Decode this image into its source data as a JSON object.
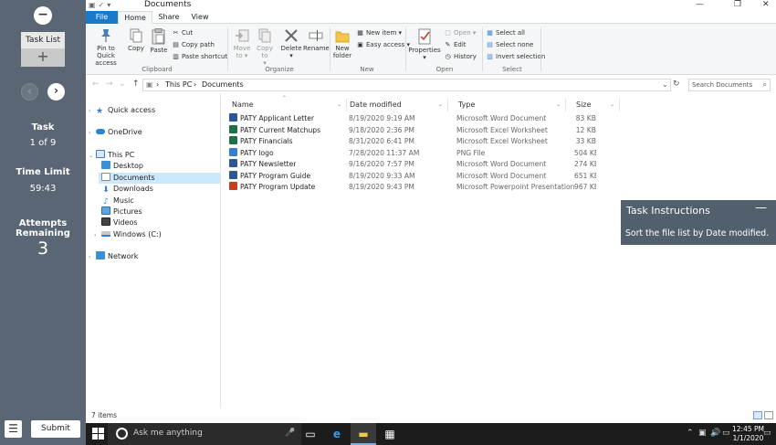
{
  "panel": {
    "minimize_glyph": "−",
    "task_list_label": "Task List",
    "task_list_add": "+",
    "prev_glyph": "‹",
    "next_glyph": "›",
    "task_heading": "Task",
    "task_value": "1 of 9",
    "time_limit_heading": "Time Limit",
    "time_limit_value": "59:43",
    "attempts_heading_1": "Attempts",
    "attempts_heading_2": "Remaining",
    "attempts_value": "3",
    "menu_glyph": "☰",
    "submit_label": "Submit"
  },
  "window": {
    "title": "Documents",
    "quick_access_glyphs": "▣✓▾",
    "minimize": "—",
    "maximize": "❐",
    "close": "✕"
  },
  "ribbon_tabs": {
    "file": "File",
    "home": "Home",
    "share": "Share",
    "view": "View"
  },
  "ribbon": {
    "pin_label_1": "Pin to Quick",
    "pin_label_2": "access",
    "copy_label": "Copy",
    "paste_label": "Paste",
    "cut_label": "Cut",
    "copy_path_label": "Copy path",
    "paste_shortcut_label": "Paste shortcut",
    "clipboard_group": "Clipboard",
    "move_to_label_1": "Move",
    "move_to_label_2": "to ▾",
    "copy_to_label_1": "Copy to",
    "copy_to_label_2": "▾",
    "delete_label_1": "Delete",
    "delete_label_2": "▾",
    "rename_label": "Rename",
    "organize_group": "Organize",
    "new_folder_label_1": "New",
    "new_folder_label_2": "folder",
    "new_item_label": "New item ▾",
    "easy_access_label": "Easy access ▾",
    "new_group": "New",
    "properties_label_1": "Properties",
    "properties_label_2": "▾",
    "open_label": "Open ▾",
    "edit_label": "Edit",
    "history_label": "History",
    "open_group": "Open",
    "select_all_label": "Select all",
    "select_none_label": "Select none",
    "invert_selection_label": "Invert selection",
    "select_group": "Select"
  },
  "address": {
    "back": "←",
    "forward": "→",
    "recent": "⌄",
    "up": "↑",
    "crumb_sep_1": "›",
    "crumb_1": "This PC",
    "crumb_sep_2": "›",
    "crumb_2": "Documents",
    "dropdown": "⌄",
    "refresh": "↻",
    "search_placeholder": "Search Documents",
    "search_glyph": "⌕"
  },
  "nav_pane": {
    "quick_access": "Quick access",
    "onedrive": "OneDrive",
    "this_pc": "This PC",
    "desktop": "Desktop",
    "documents": "Documents",
    "downloads": "Downloads",
    "music": "Music",
    "pictures": "Pictures",
    "videos": "Videos",
    "windows_c": "Windows (C:)",
    "network": "Network",
    "expand_glyph": "›",
    "expanded_glyph": "⌄"
  },
  "columns": {
    "name": "Name",
    "date_modified": "Date modified",
    "type": "Type",
    "size": "Size",
    "sort_arrow": "⌃",
    "dropdown": "⌄"
  },
  "files": [
    {
      "name": "PATY Applicant Letter",
      "date": "8/19/2020 9:19 AM",
      "type": "Microsoft Word Document",
      "size": "83 KB",
      "icon_color": "#2b5797"
    },
    {
      "name": "PATY Current Matchups",
      "date": "9/18/2020 2:36 PM",
      "type": "Microsoft Excel Worksheet",
      "size": "12 KB",
      "icon_color": "#1e7145"
    },
    {
      "name": "PATY Financials",
      "date": "8/31/2020 6:41 PM",
      "type": "Microsoft Excel Worksheet",
      "size": "33 KB",
      "icon_color": "#1e7145"
    },
    {
      "name": "PATY logo",
      "date": "7/28/2020 11:37 AM",
      "type": "PNG File",
      "size": "504 KB",
      "icon_color": "#3a7bd5"
    },
    {
      "name": "PATY Newsletter",
      "date": "9/16/2020 7:57 PM",
      "type": "Microsoft Word Document",
      "size": "274 KB",
      "icon_color": "#2b5797"
    },
    {
      "name": "PATY Program Guide",
      "date": "8/19/2020 9:33 AM",
      "type": "Microsoft Word Document",
      "size": "651 KB",
      "icon_color": "#2b5797"
    },
    {
      "name": "PATY Program Update",
      "date": "8/19/2020 9:43 PM",
      "type": "Microsoft Powerpoint Presentation",
      "size": "967 KB",
      "icon_color": "#c43e1c"
    }
  ],
  "status": {
    "item_count": "7 items"
  },
  "task_instructions": {
    "title": "Task Instructions",
    "collapse_glyph": "—",
    "body": "Sort the file list by Date modified."
  },
  "taskbar": {
    "search_placeholder": "Ask me anything",
    "mic_glyph": "🎤",
    "task_view_glyph": "▭",
    "edge_glyph": "e",
    "explorer_glyph": "▬",
    "store_glyph": "▦",
    "tray_up": "⌃",
    "tray_network": "▣",
    "tray_volume": "🔊",
    "tray_ime": "▭",
    "time": "12:45 PM",
    "date": "1/1/2020",
    "notifications_glyph": "▭"
  }
}
